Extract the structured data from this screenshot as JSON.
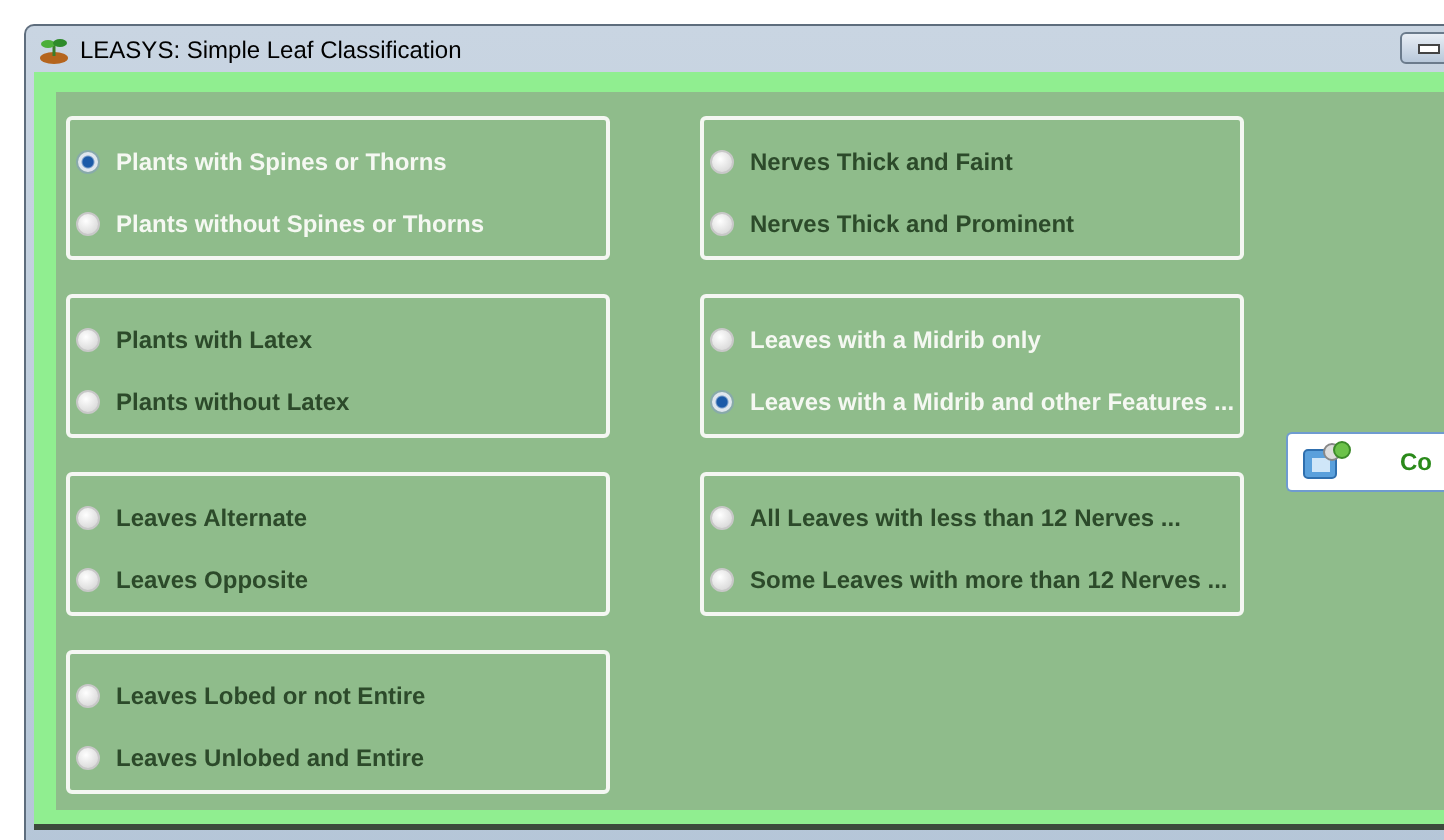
{
  "window": {
    "title": "LEASYS: Simple Leaf Classification"
  },
  "columns": [
    {
      "groups": [
        {
          "options": [
            {
              "label": "Plants with Spines or Thorns",
              "selected": true
            },
            {
              "label": "Plants without Spines or Thorns",
              "selected": false
            }
          ]
        },
        {
          "options": [
            {
              "label": "Plants with Latex",
              "selected": false
            },
            {
              "label": "Plants without Latex",
              "selected": false
            }
          ]
        },
        {
          "options": [
            {
              "label": "Leaves Alternate",
              "selected": false
            },
            {
              "label": "Leaves Opposite",
              "selected": false
            }
          ]
        },
        {
          "options": [
            {
              "label": "Leaves Lobed or not Entire",
              "selected": false
            },
            {
              "label": "Leaves Unlobed and Entire",
              "selected": false
            }
          ]
        }
      ]
    },
    {
      "groups": [
        {
          "options": [
            {
              "label": "Nerves Thick and Faint",
              "selected": false
            },
            {
              "label": "Nerves Thick and Prominent",
              "selected": false
            }
          ]
        },
        {
          "options": [
            {
              "label": "Leaves with a Midrib only",
              "selected": false
            },
            {
              "label": "Leaves with a Midrib and other Features ...",
              "selected": true
            }
          ]
        },
        {
          "options": [
            {
              "label": "All Leaves with less than 12 Nerves ...",
              "selected": false
            },
            {
              "label": "Some Leaves with more than 12 Nerves ...",
              "selected": false
            }
          ]
        }
      ]
    }
  ],
  "side_button": {
    "label": "Co"
  }
}
